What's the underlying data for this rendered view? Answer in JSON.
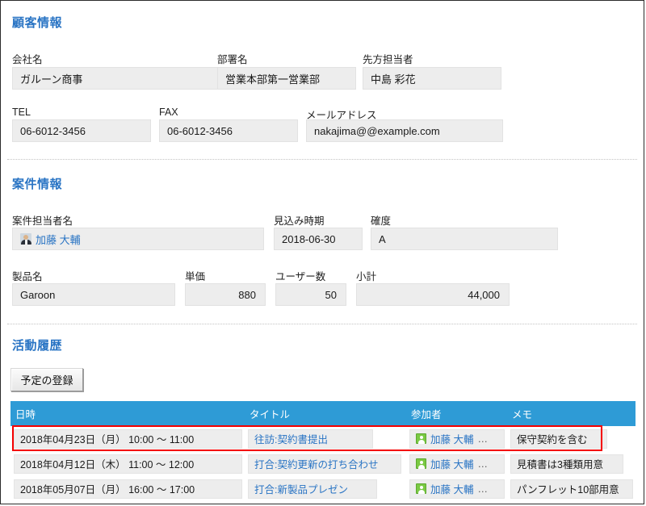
{
  "sections": {
    "customer": {
      "title": "顧客情報",
      "fields": [
        {
          "label": "会社名",
          "value": "ガルーン商事"
        },
        {
          "label": "部署名",
          "value": "営業本部第一営業部"
        },
        {
          "label": "先方担当者",
          "value": "中島 彩花"
        },
        {
          "label": "TEL",
          "value": "06-6012-3456"
        },
        {
          "label": "FAX",
          "value": "06-6012-3456"
        },
        {
          "label": "メールアドレス",
          "value": "nakajima@@example.com"
        }
      ]
    },
    "deal": {
      "title": "案件情報",
      "assignee_label": "案件担当者名",
      "assignee_value": "加藤 大輔",
      "fields": [
        {
          "label": "見込み時期",
          "value": "2018-06-30"
        },
        {
          "label": "確度",
          "value": "A"
        },
        {
          "label": "製品名",
          "value": "Garoon"
        },
        {
          "label": "単価",
          "value": "880"
        },
        {
          "label": "ユーザー数",
          "value": "50"
        },
        {
          "label": "小計",
          "value": "44,000"
        }
      ]
    },
    "activity": {
      "title": "活動履歴",
      "add_button_label": "予定の登録",
      "columns": [
        "日時",
        "タイトル",
        "参加者",
        "メモ"
      ],
      "rows": [
        {
          "datetime": "2018年04月23日（月） 10:00 ～ 11:00",
          "title": "往訪:契約書提出",
          "participant": "加藤 大輔",
          "participant_more": "…",
          "memo": "保守契約を含む",
          "highlighted": true
        },
        {
          "datetime": "2018年04月12日（木） 11:00 ～ 12:00",
          "title": "打合:契約更新の打ち合わせ",
          "participant": "加藤 大輔",
          "participant_more": "…",
          "memo": "見積書は3種類用意",
          "highlighted": false
        },
        {
          "datetime": "2018年05月07日（月） 16:00 ～ 17:00",
          "title": "打合:新製品プレゼン",
          "participant": "加藤 大輔",
          "participant_more": "…",
          "memo": "パンフレット10部用意",
          "highlighted": false
        }
      ]
    }
  },
  "colors": {
    "heading": "#2974c4",
    "link": "#2974c4",
    "table_header": "#2e9bd6",
    "field_fill": "#ededed",
    "highlight": "#f40000",
    "participant_icon": "#7ac943"
  }
}
